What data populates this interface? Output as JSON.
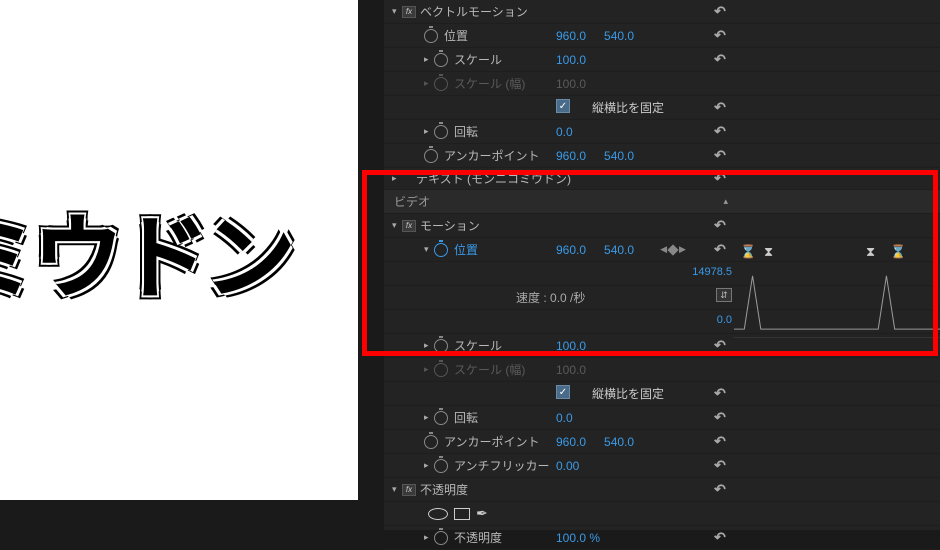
{
  "preview": {
    "text": "ミウドン"
  },
  "effects": {
    "vector_motion": {
      "title": "ベクトルモーション",
      "position": {
        "label": "位置",
        "x": "960.0",
        "y": "540.0"
      },
      "scale": {
        "label": "スケール",
        "value": "100.0"
      },
      "scale_w": {
        "label": "スケール (幅)",
        "value": "100.0"
      },
      "lock_aspect": {
        "label": "縦横比を固定",
        "checked": true
      },
      "rotation": {
        "label": "回転",
        "value": "0.0"
      },
      "anchor": {
        "label": "アンカーポイント",
        "x": "960.0",
        "y": "540.0"
      }
    },
    "text_group": {
      "title": "テキスト (モンニコミウドン)"
    },
    "video_header": "ビデオ",
    "motion": {
      "title": "モーション",
      "position": {
        "label": "位置",
        "x": "960.0",
        "y": "540.0"
      },
      "velocity": {
        "label": "速度 :",
        "value": "0.0",
        "unit": "/秒",
        "upper": "14978.5",
        "lower": "0.0"
      },
      "scale": {
        "label": "スケール",
        "value": "100.0"
      },
      "scale_w": {
        "label": "スケール (幅)",
        "value": "100.0"
      },
      "lock_aspect": {
        "label": "縦横比を固定",
        "checked": true
      },
      "rotation": {
        "label": "回転",
        "value": "0.0"
      },
      "anchor": {
        "label": "アンカーポイント",
        "x": "960.0",
        "y": "540.0"
      },
      "antiflicker": {
        "label": "アンチフリッカー",
        "value": "0.00"
      }
    },
    "opacity": {
      "title": "不透明度",
      "track": {
        "label": "不透明度",
        "value": "100.0 %"
      }
    }
  }
}
